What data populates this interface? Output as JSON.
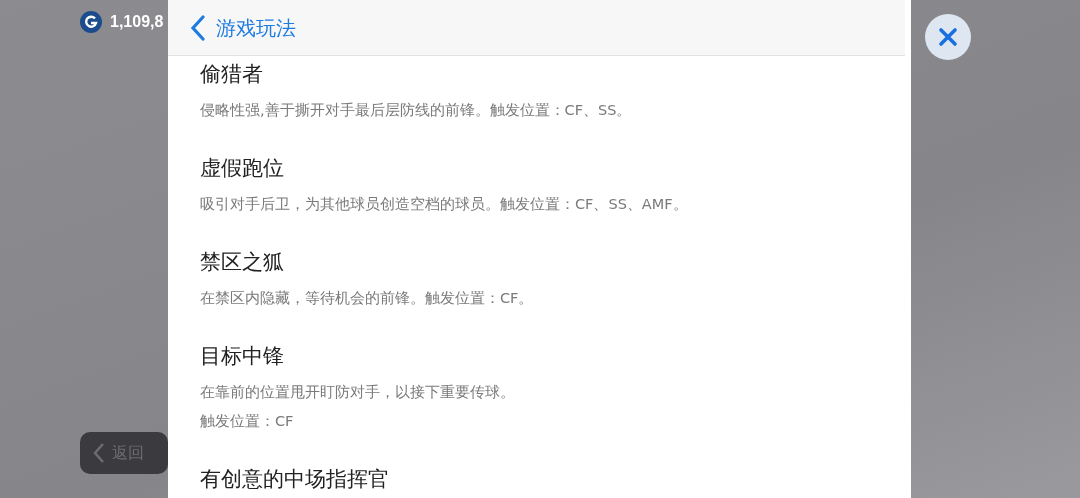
{
  "background": {
    "coins": "1,109,8",
    "back_button": {
      "label": "返回"
    }
  },
  "panel": {
    "title": "游戏玩法",
    "items": [
      {
        "title": "偷猎者",
        "lines": [
          "侵略性强,善于撕开对手最后层防线的前锋。触发位置：CF、SS。"
        ]
      },
      {
        "title": "虚假跑位",
        "lines": [
          "吸引对手后卫，为其他球员创造空档的球员。触发位置：CF、SS、AMF。"
        ]
      },
      {
        "title": "禁区之狐",
        "lines": [
          "在禁区内隐藏，等待机会的前锋。触发位置：CF。"
        ]
      },
      {
        "title": "目标中锋",
        "lines": [
          "在靠前的位置甩开盯防对手，以接下重要传球。",
          "触发位置：CF"
        ]
      },
      {
        "title": "有创意的中场指挥官"
      }
    ]
  }
}
